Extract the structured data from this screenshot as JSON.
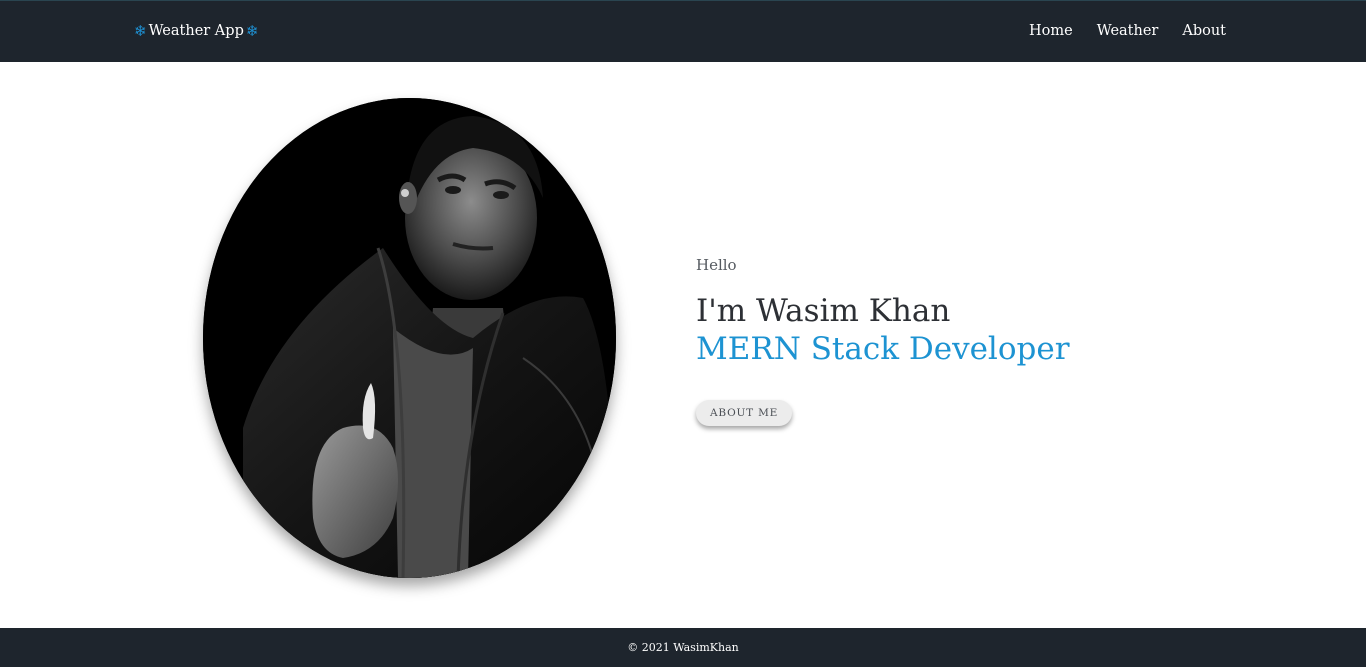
{
  "navbar": {
    "brand_icon": "snowflake-icon",
    "brand_label": "Weather App",
    "links": [
      {
        "label": "Home"
      },
      {
        "label": "Weather"
      },
      {
        "label": "About"
      }
    ]
  },
  "hero": {
    "greeting": "Hello",
    "name": "I'm Wasim Khan",
    "role": "MERN Stack Developer",
    "button_label": "ABOUT ME"
  },
  "footer": {
    "copyright": "© 2021 WasimKhan"
  },
  "colors": {
    "navbar_bg": "#1e252d",
    "accent": "#1d93d2",
    "text_dark": "#2d3035"
  }
}
